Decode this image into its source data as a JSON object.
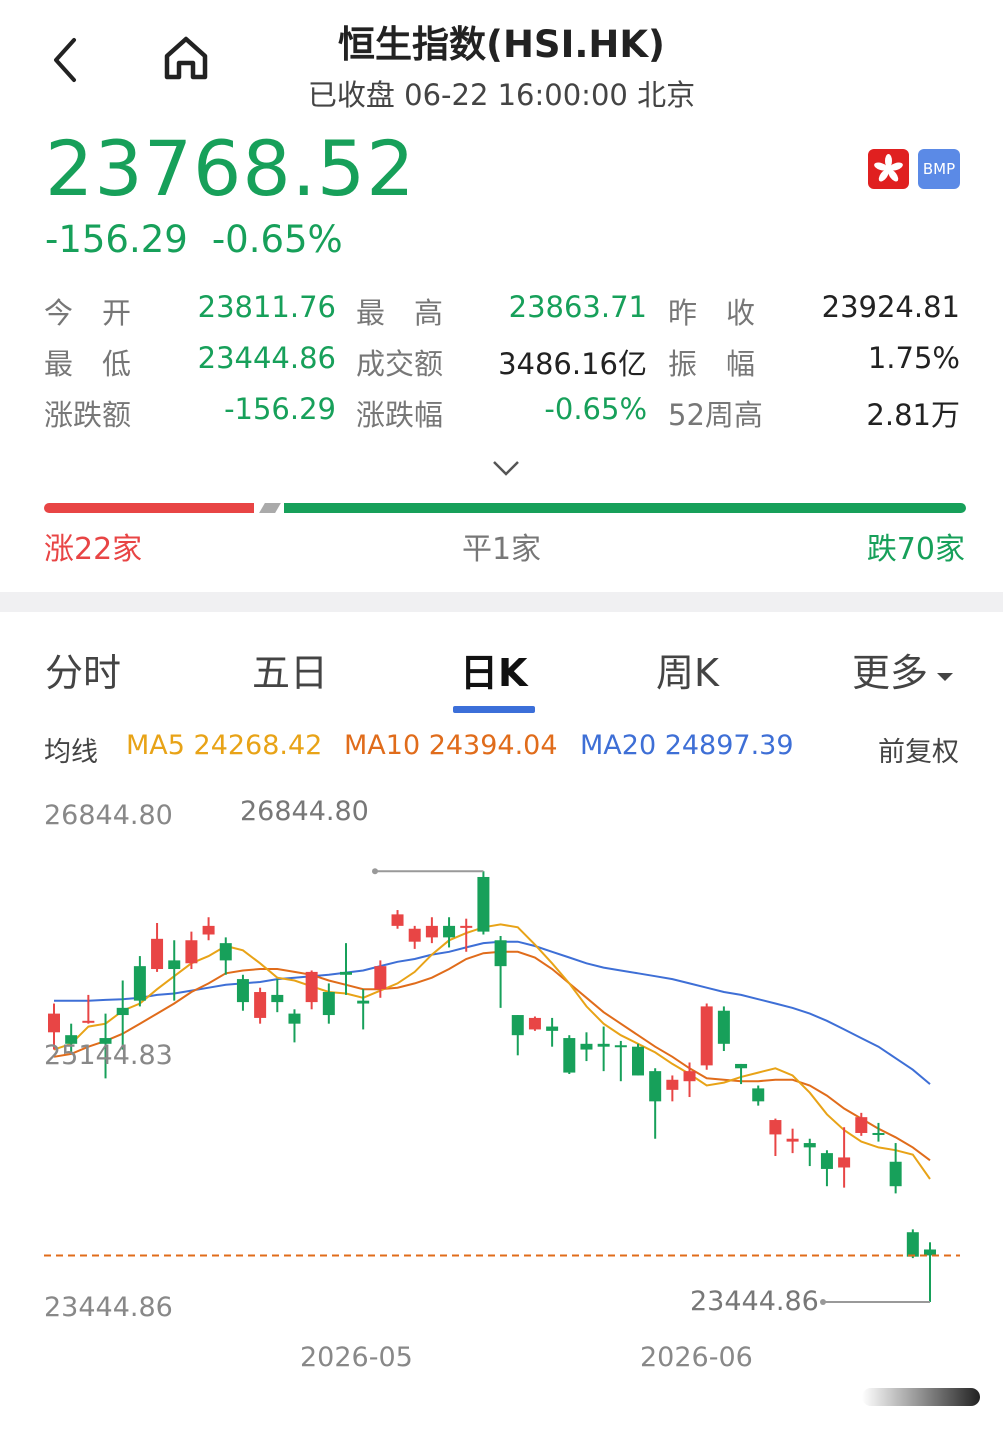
{
  "header": {
    "title": "恒生指数(HSI.HK)",
    "subtitle": "已收盘 06-22 16:00:00 北京"
  },
  "quote": {
    "price": "23768.52",
    "change": "-156.29",
    "change_pct": "-0.65%",
    "badge_bmp": "BMP",
    "up_color": "#e84545",
    "down_color": "#17a05a"
  },
  "stats": [
    [
      {
        "label": "今　开",
        "value": "23811.76"
      },
      {
        "label": "最　高",
        "value": "23863.71"
      },
      {
        "label": "昨　收",
        "value": "23924.81"
      }
    ],
    [
      {
        "label": "最　低",
        "value": "23444.86"
      },
      {
        "label": "成交额",
        "value": "3486.16亿"
      },
      {
        "label": "振　幅",
        "value": "1.75%"
      }
    ],
    [
      {
        "label": "涨跌额",
        "value": "-156.29"
      },
      {
        "label": "涨跌幅",
        "value": "-0.65%"
      },
      {
        "label": "52周高",
        "value": "2.81万"
      }
    ]
  ],
  "breadth": {
    "up": "涨22家",
    "flat": "平1家",
    "down": "跌70家",
    "up_count": 22,
    "flat_count": 1,
    "down_count": 70
  },
  "tabs": [
    "分时",
    "五日",
    "日K",
    "周K",
    "更多"
  ],
  "active_tab": "日K",
  "ma_bar": {
    "label": "均线",
    "ma5": "MA5 24268.42",
    "ma10": "MA10 24394.04",
    "ma20": "MA20 24897.39",
    "adjust": "前复权",
    "ma5_color": "#e8a317",
    "ma10_color": "#e06c1b",
    "ma20_color": "#3e6fd6"
  },
  "chart_data": {
    "type": "candlestick",
    "y_ticks": [
      "26844.80",
      "25144.83",
      "23444.86"
    ],
    "x_ticks": [
      "2026-05",
      "2026-06"
    ],
    "max_label": "26844.80",
    "min_label": "23444.86",
    "current_price_line": 23768.52,
    "ylim": [
      23444.86,
      26844.8
    ],
    "candles": [
      {
        "o": 25450,
        "c": 25320,
        "h": 25520,
        "l": 25200,
        "dir": "up"
      },
      {
        "o": 25300,
        "c": 25240,
        "h": 25380,
        "l": 25180,
        "dir": "down"
      },
      {
        "o": 25400,
        "c": 25390,
        "h": 25580,
        "l": 25380,
        "dir": "up"
      },
      {
        "o": 25240,
        "c": 25280,
        "h": 25450,
        "l": 25000,
        "dir": "down"
      },
      {
        "o": 25440,
        "c": 25490,
        "h": 25680,
        "l": 25200,
        "dir": "down"
      },
      {
        "o": 25540,
        "c": 25780,
        "h": 25850,
        "l": 25500,
        "dir": "down"
      },
      {
        "o": 25970,
        "c": 25760,
        "h": 26080,
        "l": 25740,
        "dir": "up"
      },
      {
        "o": 25760,
        "c": 25820,
        "h": 25960,
        "l": 25540,
        "dir": "down"
      },
      {
        "o": 25800,
        "c": 25960,
        "h": 26020,
        "l": 25760,
        "dir": "up"
      },
      {
        "o": 26060,
        "c": 26000,
        "h": 26120,
        "l": 25960,
        "dir": "up"
      },
      {
        "o": 25820,
        "c": 25940,
        "h": 25980,
        "l": 25720,
        "dir": "down"
      },
      {
        "o": 25690,
        "c": 25530,
        "h": 25720,
        "l": 25470,
        "dir": "down"
      },
      {
        "o": 25600,
        "c": 25420,
        "h": 25630,
        "l": 25380,
        "dir": "up"
      },
      {
        "o": 25580,
        "c": 25530,
        "h": 25690,
        "l": 25460,
        "dir": "down"
      },
      {
        "o": 25450,
        "c": 25380,
        "h": 25480,
        "l": 25250,
        "dir": "down"
      },
      {
        "o": 25740,
        "c": 25530,
        "h": 25750,
        "l": 25480,
        "dir": "up"
      },
      {
        "o": 25440,
        "c": 25600,
        "h": 25660,
        "l": 25380,
        "dir": "down"
      },
      {
        "o": 25740,
        "c": 25720,
        "h": 25940,
        "l": 25580,
        "dir": "down"
      },
      {
        "o": 25520,
        "c": 25540,
        "h": 25620,
        "l": 25340,
        "dir": "down"
      },
      {
        "o": 25620,
        "c": 25780,
        "h": 25820,
        "l": 25560,
        "dir": "up"
      },
      {
        "o": 26140,
        "c": 26060,
        "h": 26170,
        "l": 26040,
        "dir": "up"
      },
      {
        "o": 25950,
        "c": 26040,
        "h": 26060,
        "l": 25900,
        "dir": "up"
      },
      {
        "o": 25980,
        "c": 26060,
        "h": 26120,
        "l": 25940,
        "dir": "up"
      },
      {
        "o": 25980,
        "c": 26060,
        "h": 26120,
        "l": 25910,
        "dir": "down"
      },
      {
        "o": 26060,
        "c": 26060,
        "h": 26110,
        "l": 25880,
        "dir": "up"
      },
      {
        "o": 26400,
        "c": 26020,
        "h": 26440,
        "l": 26000,
        "dir": "down"
      },
      {
        "o": 25960,
        "c": 25780,
        "h": 25990,
        "l": 25490,
        "dir": "down"
      },
      {
        "o": 25440,
        "c": 25300,
        "h": 25440,
        "l": 25160,
        "dir": "down"
      },
      {
        "o": 25420,
        "c": 25340,
        "h": 25430,
        "l": 25330,
        "dir": "up"
      },
      {
        "o": 25330,
        "c": 25360,
        "h": 25420,
        "l": 25220,
        "dir": "down"
      },
      {
        "o": 25280,
        "c": 25040,
        "h": 25300,
        "l": 25030,
        "dir": "down"
      },
      {
        "o": 25240,
        "c": 25200,
        "h": 25320,
        "l": 25120,
        "dir": "down"
      },
      {
        "o": 25240,
        "c": 25220,
        "h": 25360,
        "l": 25050,
        "dir": "down"
      },
      {
        "o": 25220,
        "c": 25230,
        "h": 25260,
        "l": 24980,
        "dir": "down"
      },
      {
        "o": 25220,
        "c": 25020,
        "h": 25240,
        "l": 25020,
        "dir": "down"
      },
      {
        "o": 25050,
        "c": 24840,
        "h": 25070,
        "l": 24580,
        "dir": "down"
      },
      {
        "o": 24920,
        "c": 24990,
        "h": 25020,
        "l": 24840,
        "dir": "up"
      },
      {
        "o": 24980,
        "c": 25050,
        "h": 25110,
        "l": 24870,
        "dir": "up"
      },
      {
        "o": 25500,
        "c": 25090,
        "h": 25520,
        "l": 25060,
        "dir": "up"
      },
      {
        "o": 25470,
        "c": 25240,
        "h": 25500,
        "l": 25190,
        "dir": "down"
      },
      {
        "o": 25070,
        "c": 25100,
        "h": 25100,
        "l": 24960,
        "dir": "down"
      },
      {
        "o": 24840,
        "c": 24930,
        "h": 24950,
        "l": 24810,
        "dir": "down"
      },
      {
        "o": 24710,
        "c": 24610,
        "h": 24720,
        "l": 24460,
        "dir": "up"
      },
      {
        "o": 24560,
        "c": 24580,
        "h": 24650,
        "l": 24480,
        "dir": "up"
      },
      {
        "o": 24550,
        "c": 24520,
        "h": 24580,
        "l": 24390,
        "dir": "down"
      },
      {
        "o": 24480,
        "c": 24370,
        "h": 24500,
        "l": 24250,
        "dir": "down"
      },
      {
        "o": 24380,
        "c": 24450,
        "h": 24660,
        "l": 24240,
        "dir": "up"
      },
      {
        "o": 24730,
        "c": 24620,
        "h": 24760,
        "l": 24600,
        "dir": "up"
      },
      {
        "o": 24620,
        "c": 24620,
        "h": 24690,
        "l": 24560,
        "dir": "down"
      },
      {
        "o": 24420,
        "c": 24250,
        "h": 24550,
        "l": 24200,
        "dir": "down"
      },
      {
        "o": 23930,
        "c": 23760,
        "h": 23950,
        "l": 23750,
        "dir": "down"
      },
      {
        "o": 23810,
        "c": 23769,
        "h": 23860,
        "l": 23445,
        "dir": "down"
      }
    ],
    "ma5": [
      25200,
      25240,
      25360,
      25380,
      25470,
      25520,
      25620,
      25710,
      25800,
      25850,
      25920,
      25890,
      25800,
      25700,
      25680,
      25640,
      25600,
      25590,
      25560,
      25610,
      25660,
      25740,
      25860,
      25960,
      26010,
      26050,
      26070,
      26050,
      25930,
      25800,
      25660,
      25500,
      25380,
      25300,
      25240,
      25180,
      25100,
      25030,
      24950,
      24970,
      25010,
      25040,
      25070,
      25020,
      24900,
      24750,
      24640,
      24560,
      24520,
      24500,
      24470,
      24300
    ],
    "ma10": [
      25150,
      25170,
      25220,
      25260,
      25310,
      25380,
      25450,
      25520,
      25600,
      25660,
      25730,
      25750,
      25760,
      25760,
      25740,
      25720,
      25680,
      25650,
      25620,
      25620,
      25630,
      25660,
      25700,
      25760,
      25830,
      25870,
      25880,
      25880,
      25840,
      25760,
      25660,
      25560,
      25460,
      25380,
      25300,
      25220,
      25150,
      25070,
      25000,
      24990,
      24980,
      24980,
      24990,
      24990,
      24950,
      24880,
      24790,
      24720,
      24650,
      24590,
      24520,
      24430
    ],
    "ma20": [
      25540,
      25540,
      25540,
      25545,
      25550,
      25560,
      25580,
      25590,
      25610,
      25630,
      25650,
      25660,
      25670,
      25690,
      25700,
      25710,
      25720,
      25735,
      25750,
      25780,
      25810,
      25830,
      25860,
      25880,
      25910,
      25940,
      25950,
      25950,
      25920,
      25880,
      25840,
      25800,
      25770,
      25750,
      25730,
      25710,
      25690,
      25660,
      25630,
      25600,
      25580,
      25550,
      25520,
      25490,
      25450,
      25400,
      25340,
      25280,
      25220,
      25140,
      25060,
      24960
    ]
  }
}
